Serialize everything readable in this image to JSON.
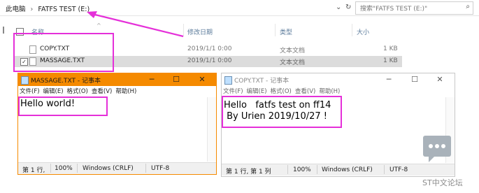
{
  "explorer": {
    "breadcrumb": {
      "pc": "此电脑",
      "separator": "›",
      "drive": "FATFS TEST (E:)"
    },
    "search_placeholder": "搜索\"FATFS TEST (E:)\"",
    "columns": {
      "name": "名称",
      "modified": "修改日期",
      "type": "类型",
      "size": "大小"
    },
    "files": [
      {
        "name": "COPY.TXT",
        "modified": "2019/1/1 0:00",
        "type": "文本文档",
        "size": "1 KB",
        "selected": false
      },
      {
        "name": "MASSAGE.TXT",
        "modified": "2019/1/1 0:00",
        "type": "文本文档",
        "size": "1 KB",
        "selected": true
      }
    ]
  },
  "notepad_massage": {
    "title": "MASSAGE.TXT - 记事本",
    "menu": [
      "文件(F)",
      "编辑(E)",
      "格式(O)",
      "查看(V)",
      "帮助(H)"
    ],
    "content": "Hello world!",
    "status": {
      "position": "第 1 行,",
      "zoom": "100%",
      "line_ending": "Windows (CRLF)",
      "encoding": "UTF-8"
    },
    "titlebar_color": "#f58a00"
  },
  "notepad_copy": {
    "title": "COPY.TXT - 记事本",
    "menu": [
      "文件(F)",
      "编辑(E)",
      "格式(O)",
      "查看(V)",
      "帮助(H)"
    ],
    "line1": "Hello   fatfs test on ff14",
    "line2": " By Urien 2019/10/27 !",
    "status": {
      "position": "第 1 行, 第 1 列",
      "zoom": "100%",
      "line_ending": "Windows (CRLF)",
      "encoding": "UTF-8"
    }
  },
  "watermark": {
    "text": "ST中文论坛"
  },
  "colors": {
    "highlight": "#e530d9",
    "active_title": "#f58a00"
  },
  "icons": [
    "chevron-down-icon",
    "refresh-icon",
    "search-icon",
    "notepad-icon",
    "minimize-icon",
    "maximize-icon",
    "close-icon",
    "chat-bubble-icon",
    "text-file-icon",
    "checkbox-icon",
    "arrow-icon"
  ]
}
